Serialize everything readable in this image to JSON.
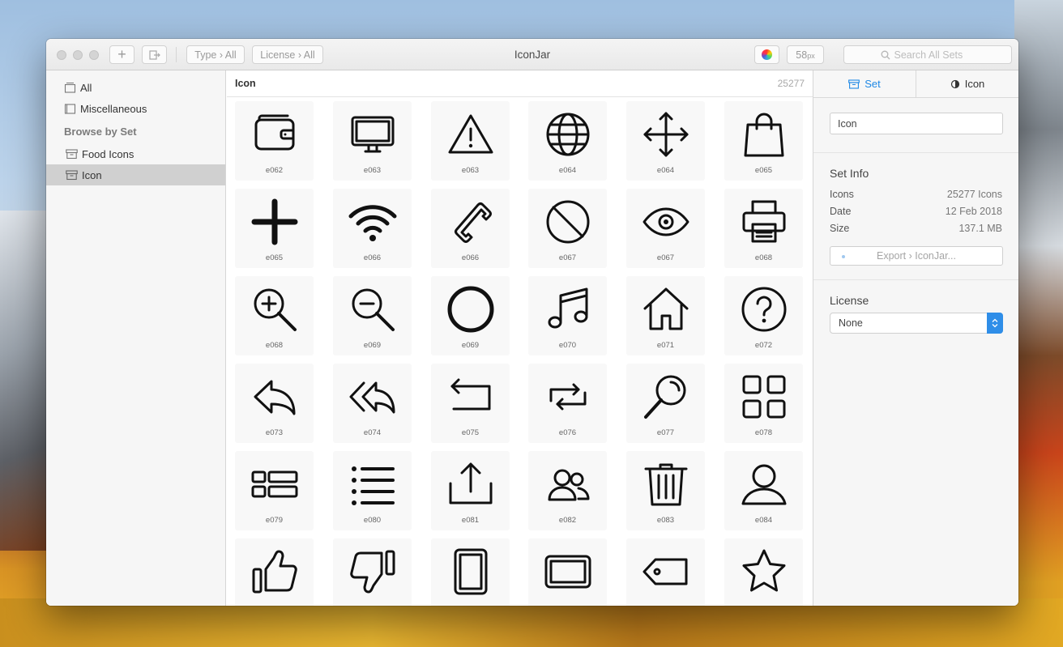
{
  "window": {
    "title": "IconJar"
  },
  "toolbar": {
    "add_label": "+",
    "type_filter": "Type › All",
    "license_filter": "License › All",
    "size_label": "58",
    "size_unit": "px",
    "search_placeholder": "Search All Sets"
  },
  "sidebar": {
    "items": [
      {
        "label": "All"
      },
      {
        "label": "Miscellaneous"
      }
    ],
    "browse_header": "Browse by Set",
    "sets": [
      {
        "label": "Food Icons"
      },
      {
        "label": "Icon",
        "selected": true
      }
    ]
  },
  "main": {
    "header_label": "Icon",
    "count": "25277",
    "icons": [
      {
        "name": "wallet-icon",
        "caption": "e062"
      },
      {
        "name": "monitor-icon",
        "caption": "e063"
      },
      {
        "name": "warning-icon",
        "caption": "e063"
      },
      {
        "name": "globe-icon",
        "caption": "e064"
      },
      {
        "name": "move-arrows-icon",
        "caption": "e064"
      },
      {
        "name": "shopping-bag-icon",
        "caption": "e065"
      },
      {
        "name": "plus-icon",
        "caption": "e065"
      },
      {
        "name": "wifi-icon",
        "caption": "e066"
      },
      {
        "name": "phone-icon",
        "caption": "e066"
      },
      {
        "name": "prohibited-icon",
        "caption": "e067"
      },
      {
        "name": "eye-icon",
        "caption": "e067"
      },
      {
        "name": "printer-icon",
        "caption": "e068"
      },
      {
        "name": "zoom-in-icon",
        "caption": "e068"
      },
      {
        "name": "zoom-out-icon",
        "caption": "e069"
      },
      {
        "name": "circle-icon",
        "caption": "e069"
      },
      {
        "name": "music-note-icon",
        "caption": "e070"
      },
      {
        "name": "home-icon",
        "caption": "e071"
      },
      {
        "name": "help-icon",
        "caption": "e072"
      },
      {
        "name": "reply-icon",
        "caption": "e073"
      },
      {
        "name": "reply-all-icon",
        "caption": "e074"
      },
      {
        "name": "return-icon",
        "caption": "e075"
      },
      {
        "name": "repeat-icon",
        "caption": "e076"
      },
      {
        "name": "search-icon",
        "caption": "e077"
      },
      {
        "name": "grid-icon",
        "caption": "e078"
      },
      {
        "name": "list-blocks-icon",
        "caption": "e079"
      },
      {
        "name": "list-icon",
        "caption": "e080"
      },
      {
        "name": "upload-icon",
        "caption": "e081"
      },
      {
        "name": "users-icon",
        "caption": "e082"
      },
      {
        "name": "trash-icon",
        "caption": "e083"
      },
      {
        "name": "user-icon",
        "caption": "e084"
      },
      {
        "name": "thumbs-up-icon",
        "caption": ""
      },
      {
        "name": "thumbs-down-icon",
        "caption": ""
      },
      {
        "name": "tablet-portrait-icon",
        "caption": ""
      },
      {
        "name": "tablet-landscape-icon",
        "caption": ""
      },
      {
        "name": "tag-icon",
        "caption": ""
      },
      {
        "name": "star-icon",
        "caption": ""
      }
    ]
  },
  "inspector": {
    "tabs": [
      {
        "label": "Set",
        "active": true
      },
      {
        "label": "Icon"
      }
    ],
    "set_name": "Icon",
    "set_info_title": "Set Info",
    "info": [
      {
        "key": "Icons",
        "value": "25277 Icons"
      },
      {
        "key": "Date",
        "value": "12 Feb 2018"
      },
      {
        "key": "Size",
        "value": "137.1 MB"
      }
    ],
    "export_label": "Export › IconJar...",
    "license_title": "License",
    "license_value": "None"
  },
  "colors": {
    "accent": "#1e88e5",
    "selection": "#d0d0d0"
  }
}
